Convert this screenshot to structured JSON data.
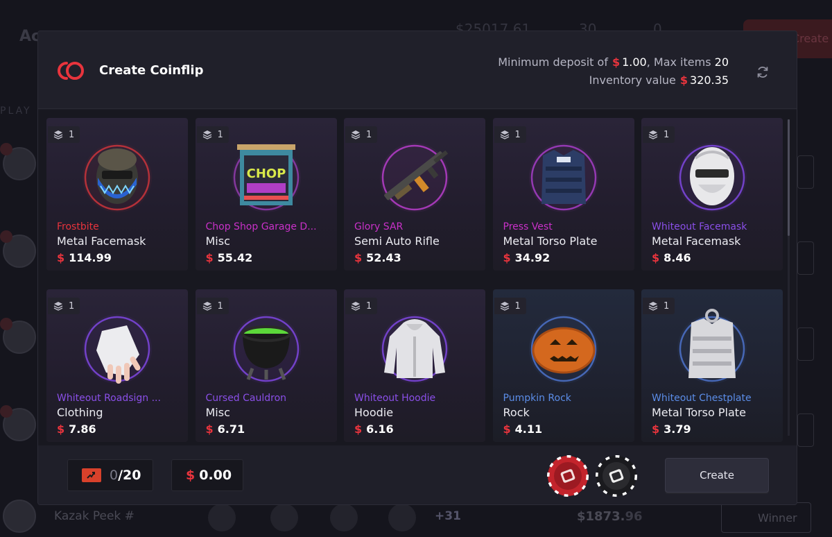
{
  "background": {
    "title": "Ac",
    "stat_value": "$25017.61",
    "stat_count": "30",
    "stat_zero": "0",
    "create_label": "Create",
    "players_label": "PLAY",
    "last_row": {
      "name": "Kazak Peek #",
      "more": "+31",
      "total_main": "$1873.",
      "total_dim": "96",
      "winner_label": "Winner"
    }
  },
  "modal": {
    "title": "Create Coinflip",
    "min_deposit_label": "Minimum deposit of",
    "currency": "$",
    "min_deposit_value": "1.00",
    "max_items_label": ", Max items",
    "max_items_value": "20",
    "inventory_label": "Inventory value",
    "inventory_value": "320.35",
    "icons": {
      "logo": "coinflip-logo-icon",
      "refresh": "refresh-icon",
      "stack": "stack-layers-icon"
    }
  },
  "items": [
    {
      "name": "Frostbite",
      "type": "Metal Facemask",
      "price": "114.99",
      "qty": "1",
      "color": "#e8343d",
      "ring": "#c4333b",
      "art": "facemask-dark"
    },
    {
      "name": "Chop Shop Garage D...",
      "type": "Misc",
      "price": "55.42",
      "qty": "1",
      "color": "#c931c9",
      "ring": "#8e3aa8",
      "art": "garage-door"
    },
    {
      "name": "Glory SAR",
      "type": "Semi Auto Rifle",
      "price": "52.43",
      "qty": "1",
      "color": "#c931c9",
      "ring": "#b03cc4",
      "art": "rifle"
    },
    {
      "name": "Press Vest",
      "type": "Metal Torso Plate",
      "price": "34.92",
      "qty": "1",
      "color": "#c931c9",
      "ring": "#a03cc0",
      "art": "vest-blue"
    },
    {
      "name": "Whiteout Facemask",
      "type": "Metal Facemask",
      "price": "8.46",
      "qty": "1",
      "color": "#8a4fe8",
      "ring": "#7a46d8",
      "art": "facemask-white"
    },
    {
      "name": "Whiteout Roadsign ...",
      "type": "Clothing",
      "price": "7.86",
      "qty": "1",
      "color": "#8a4fe8",
      "ring": "#7a46d8",
      "art": "glove"
    },
    {
      "name": "Cursed Cauldron",
      "type": "Misc",
      "price": "6.71",
      "qty": "1",
      "color": "#8a4fe8",
      "ring": "#7a46d8",
      "art": "cauldron"
    },
    {
      "name": "Whiteout Hoodie",
      "type": "Hoodie",
      "price": "6.16",
      "qty": "1",
      "color": "#8a4fe8",
      "ring": "#7a46d8",
      "art": "hoodie"
    },
    {
      "name": "Pumpkin Rock",
      "type": "Rock",
      "price": "4.11",
      "qty": "1",
      "color": "#5b8de8",
      "ring": "#4a6fc4",
      "art": "pumpkin"
    },
    {
      "name": "Whiteout Chestplate",
      "type": "Metal Torso Plate",
      "price": "3.79",
      "qty": "1",
      "color": "#5b8de8",
      "ring": "#4a6fc4",
      "art": "chestplate"
    }
  ],
  "footer": {
    "selected_count": "0",
    "max_count": "/20",
    "currency": "$",
    "selected_value": "0.00",
    "create_label": "Create",
    "chips": [
      "red-coin-chip-icon",
      "black-coin-chip-icon"
    ]
  }
}
